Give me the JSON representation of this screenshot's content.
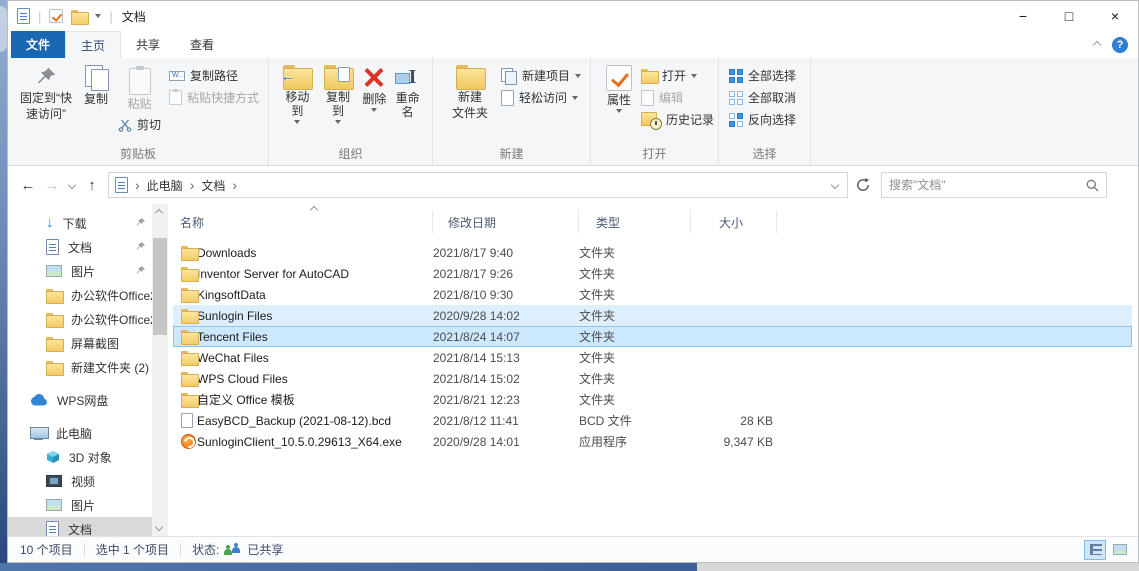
{
  "window": {
    "title": "文档",
    "minimize": "−",
    "maximize": "□",
    "close": "×",
    "help": "?"
  },
  "tabs": {
    "file": "文件",
    "home": "主页",
    "share": "共享",
    "view": "查看"
  },
  "ribbon": {
    "clipboard": {
      "group": "剪贴板",
      "pin_line1": "固定到“快",
      "pin_line2": "速访问”",
      "copy": "复制",
      "paste": "粘贴",
      "cut": "剪切",
      "copy_path": "复制路径",
      "paste_shortcut": "粘贴快捷方式"
    },
    "organize": {
      "group": "组织",
      "move_to": "移动到",
      "copy_to": "复制到",
      "delete": "删除",
      "rename": "重命名"
    },
    "create": {
      "group": "新建",
      "new_folder_line1": "新建",
      "new_folder_line2": "文件夹",
      "new_item": "新建项目",
      "easy_access": "轻松访问"
    },
    "open": {
      "group": "打开",
      "properties": "属性",
      "open": "打开",
      "edit": "编辑",
      "history": "历史记录"
    },
    "select": {
      "group": "选择",
      "select_all": "全部选择",
      "select_none": "全部取消",
      "invert": "反向选择"
    }
  },
  "navbar": {
    "breadcrumb_root": "此电脑",
    "breadcrumb_current": "文档",
    "search_placeholder": "搜索\"文档\""
  },
  "sidebar": {
    "items": [
      {
        "label": "下载",
        "icon": "download-arrow",
        "pinned": true
      },
      {
        "label": "文档",
        "icon": "document",
        "pinned": true
      },
      {
        "label": "图片",
        "icon": "picture",
        "pinned": true
      },
      {
        "label": "办公软件Office2",
        "icon": "folder"
      },
      {
        "label": "办公软件Office2",
        "icon": "folder"
      },
      {
        "label": "屏幕截图",
        "icon": "folder"
      },
      {
        "label": "新建文件夹 (2)",
        "icon": "folder"
      },
      {
        "label": "WPS网盘",
        "icon": "cloud"
      },
      {
        "label": "此电脑",
        "icon": "computer"
      },
      {
        "label": "3D 对象",
        "icon": "cube"
      },
      {
        "label": "视频",
        "icon": "film"
      },
      {
        "label": "图片",
        "icon": "picture"
      },
      {
        "label": "文档",
        "icon": "document",
        "selected": true
      }
    ]
  },
  "filelist": {
    "columns": {
      "name": "名称",
      "date": "修改日期",
      "type": "类型",
      "size": "大小"
    },
    "rows": [
      {
        "name": "Downloads",
        "date": "2021/8/17 9:40",
        "type": "文件夹",
        "size": "",
        "icon": "folder"
      },
      {
        "name": "Inventor Server for AutoCAD",
        "date": "2021/8/17 9:26",
        "type": "文件夹",
        "size": "",
        "icon": "folder"
      },
      {
        "name": "KingsoftData",
        "date": "2021/8/10 9:30",
        "type": "文件夹",
        "size": "",
        "icon": "folder"
      },
      {
        "name": "Sunlogin Files",
        "date": "2020/9/28 14:02",
        "type": "文件夹",
        "size": "",
        "icon": "folder",
        "state": "hover"
      },
      {
        "name": "Tencent Files",
        "date": "2021/8/24 14:07",
        "type": "文件夹",
        "size": "",
        "icon": "folder",
        "state": "selected"
      },
      {
        "name": "WeChat Files",
        "date": "2021/8/14 15:13",
        "type": "文件夹",
        "size": "",
        "icon": "folder"
      },
      {
        "name": "WPS Cloud Files",
        "date": "2021/8/14 15:02",
        "type": "文件夹",
        "size": "",
        "icon": "folder"
      },
      {
        "name": "自定义 Office 模板",
        "date": "2021/8/21 12:23",
        "type": "文件夹",
        "size": "",
        "icon": "folder"
      },
      {
        "name": "EasyBCD_Backup (2021-08-12).bcd",
        "date": "2021/8/12 11:41",
        "type": "BCD 文件",
        "size": "28 KB",
        "icon": "file"
      },
      {
        "name": "SunloginClient_10.5.0.29613_X64.exe",
        "date": "2020/9/28 14:01",
        "type": "应用程序",
        "size": "9,347 KB",
        "icon": "app"
      }
    ]
  },
  "statusbar": {
    "item_count": "10 个项目",
    "selected_count": "选中 1 个项目",
    "status_label": "状态:",
    "shared_text": "已共享"
  },
  "colors": {
    "accent_blue": "#1767b3",
    "selection_fill": "#cce8ff",
    "selection_border": "#8fc6f0",
    "hover_fill": "#ddeefc",
    "folder_yellow": "#f3cd66",
    "delete_red": "#da3526"
  }
}
